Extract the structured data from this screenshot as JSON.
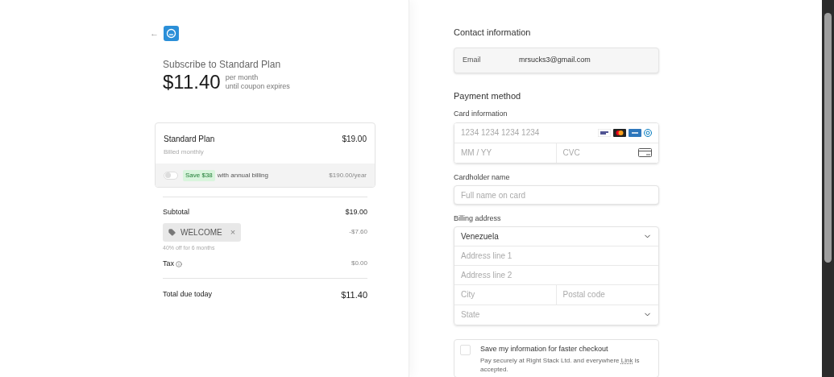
{
  "header": {
    "back_label": "←",
    "title": "Subscribe to Standard Plan",
    "price": "$11.40",
    "price_note_1": "per month",
    "price_note_2": "until coupon expires"
  },
  "plan": {
    "name": "Standard Plan",
    "price": "$19.00",
    "billing": "Billed monthly"
  },
  "annual_billing": {
    "on": false,
    "badge": "Save $38",
    "label": "with annual billing",
    "price": "$190.00/year"
  },
  "summary": {
    "subtotal_label": "Subtotal",
    "subtotal": "$19.00",
    "coupon_code": "WELCOME",
    "coupon_remove": "×",
    "coupon_amount": "-$7.60",
    "coupon_note": "40% off for 6 months",
    "tax_label": "Tax",
    "tax": "$0.00",
    "total_label": "Total due today",
    "total": "$11.40"
  },
  "contact": {
    "title": "Contact information",
    "email_label": "Email",
    "email": "mrsucks3@gmail.com"
  },
  "payment": {
    "title": "Payment method",
    "card_label": "Card information",
    "card_number_placeholder": "1234 1234 1234 1234",
    "expiry_placeholder": "MM / YY",
    "cvc_placeholder": "CVC",
    "cardholder_label": "Cardholder name",
    "cardholder_placeholder": "Full name on card"
  },
  "billing": {
    "label": "Billing address",
    "country": "Venezuela",
    "address1_placeholder": "Address line 1",
    "address2_placeholder": "Address line 2",
    "city_placeholder": "City",
    "postal_placeholder": "Postal code",
    "state_placeholder": "State"
  },
  "save_info": {
    "checked": false,
    "title": "Save my information for faster checkout",
    "text_before": "Pay securely at Right Stack Ltd. and everywhere ",
    "link": "Link",
    "text_after": " is accepted."
  }
}
